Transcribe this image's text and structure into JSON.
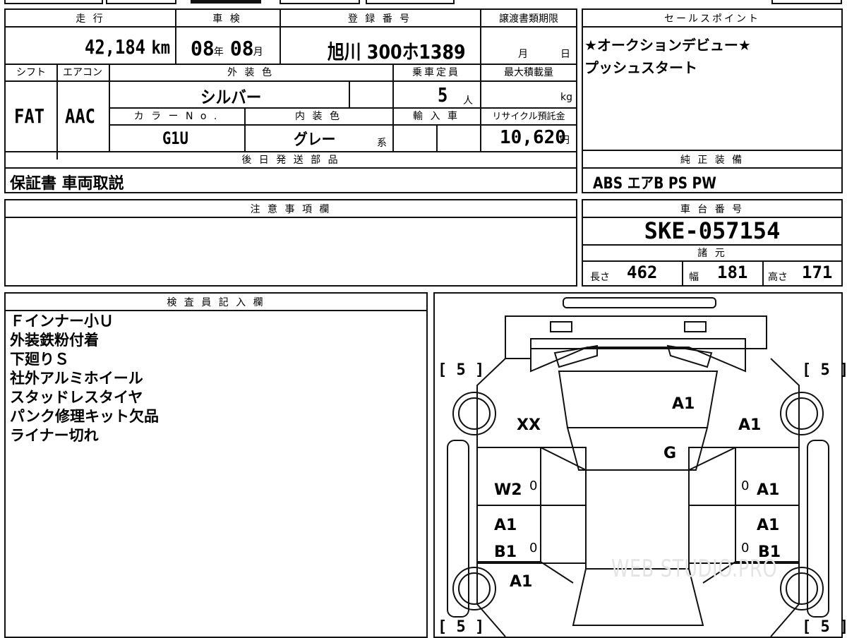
{
  "top_strip": {
    "visible": true
  },
  "vehicle": {
    "mileage_label": "走 行",
    "mileage_value": "42,184",
    "mileage_unit": "km",
    "inspection_label": "車 検",
    "inspection_year": "08",
    "inspection_year_unit": "年",
    "inspection_month": "08",
    "inspection_month_unit": "月",
    "registration_label": "登 録 番 号",
    "registration_value": "旭川 300ホ1389",
    "transfer_label": "譲渡書類期限",
    "transfer_month_unit": "月",
    "transfer_day_unit": "日",
    "shift_label": "シフト",
    "shift_value": "FAT",
    "aircon_label": "エアコン",
    "aircon_value": "AAC",
    "exterior_label": "外 装 色",
    "exterior_value": "シルバー",
    "capacity_label": "乗車定員",
    "capacity_value": "5",
    "capacity_unit": "人",
    "maxload_label": "最大積載量",
    "maxload_unit": "kg",
    "color_no_label": "カ ラ ー N o .",
    "color_no_value": "G1U",
    "interior_label": "内 装 色",
    "interior_value": "グレー",
    "interior_unit": "系",
    "import_label": "輸 入 車",
    "recycle_label": "リサイクル預託金",
    "recycle_value": "10,620",
    "recycle_unit": "円",
    "later_parts_label": "後 日 発 送 部 品",
    "later_parts_value": "保証書 車両取説"
  },
  "sales": {
    "label": "セールスポイント",
    "lines": [
      "★オークションデビュー★",
      "プッシュスタート"
    ]
  },
  "equipment": {
    "label": "純 正 装 備",
    "value": "ABS エアB PS PW"
  },
  "notes": {
    "label": "注 意 事 項 欄",
    "value": ""
  },
  "chassis": {
    "label": "車 台 番 号",
    "value": "SKE-057154",
    "spec_label": "諸 元",
    "length_label": "長さ",
    "length_value": "462",
    "width_label": "幅",
    "width_value": "181",
    "height_label": "高さ",
    "height_value": "171"
  },
  "inspector": {
    "label": "検 査 員 記 入 欄",
    "lines": [
      "Ｆインナー小Ｕ",
      "外装鉄粉付着",
      "下廻りＳ",
      "社外アルミホイール",
      "スタッドレスタイヤ",
      "パンク修理キット欠品",
      "ライナー切れ"
    ]
  },
  "diagram": {
    "tire_tl": "[ 5 ]",
    "tire_tr": "[ 5 ]",
    "tire_bl": "[ 5 ]",
    "tire_br": "[ 5 ]",
    "marks": {
      "hood_right": "A1",
      "front_left": "XX",
      "front_right": "A1",
      "windshield": "G",
      "door_fl": "W2",
      "door_fr": "A1",
      "door_rl_top": "A1",
      "door_rl_bottom": "B1",
      "door_rr_top": "A1",
      "door_rr_bottom": "B1",
      "rear_left": "A1",
      "zero_fl": "0",
      "zero_fr": "0",
      "zero_rl": "0",
      "zero_rr": "0"
    },
    "watermark": "WEB STUDIO.PRO"
  }
}
